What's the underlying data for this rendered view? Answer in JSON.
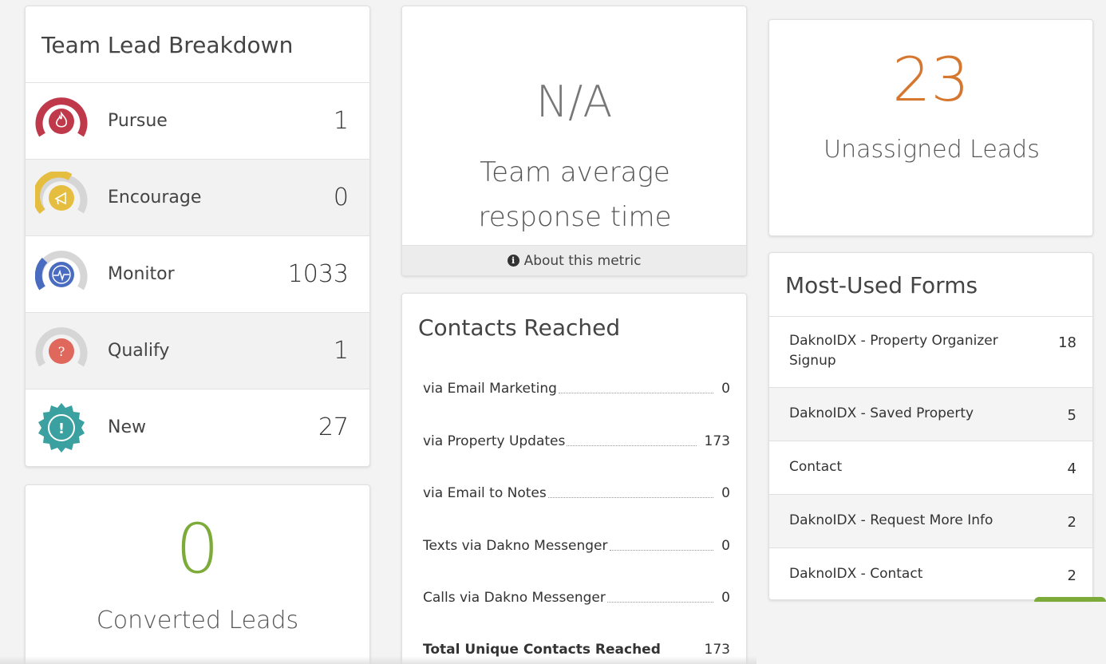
{
  "team_breakdown": {
    "title": "Team Lead Breakdown",
    "rows": [
      {
        "label": "Pursue",
        "count": "1",
        "icon": "flame-icon",
        "color": "#c0394b"
      },
      {
        "label": "Encourage",
        "count": "0",
        "icon": "megaphone-icon",
        "color": "#e6be3f"
      },
      {
        "label": "Monitor",
        "count": "1033",
        "icon": "heartbeat-icon",
        "color": "#4a6cc0"
      },
      {
        "label": "Qualify",
        "count": "1",
        "icon": "question-icon",
        "color": "#e0675b"
      },
      {
        "label": "New",
        "count": "27",
        "icon": "exclamation-icon",
        "color": "#3aa0a0"
      }
    ]
  },
  "converted": {
    "value": "0",
    "label": "Converted Leads",
    "color": "#7cab3a"
  },
  "response_time": {
    "value": "N/A",
    "label": "Team average response time",
    "about": "About this metric"
  },
  "contacts_reached": {
    "title": "Contacts Reached",
    "rows": [
      {
        "label": "via Email Marketing",
        "value": "0"
      },
      {
        "label": "via Property Updates",
        "value": "173"
      },
      {
        "label": "via Email to Notes",
        "value": "0"
      },
      {
        "label": "Texts via Dakno Messenger",
        "value": "0"
      },
      {
        "label": "Calls via Dakno Messenger",
        "value": "0"
      }
    ],
    "total": {
      "label": "Total Unique Contacts Reached",
      "value": "173"
    }
  },
  "unassigned": {
    "value": "23",
    "label": "Unassigned Leads",
    "color": "#d5772f"
  },
  "forms": {
    "title": "Most-Used Forms",
    "rows": [
      {
        "name": "DaknoIDX - Property Organizer Signup",
        "count": "18"
      },
      {
        "name": "DaknoIDX - Saved Property",
        "count": "5"
      },
      {
        "name": "Contact",
        "count": "4"
      },
      {
        "name": "DaknoIDX - Request More Info",
        "count": "2"
      },
      {
        "name": "DaknoIDX - Contact",
        "count": "2"
      }
    ]
  }
}
